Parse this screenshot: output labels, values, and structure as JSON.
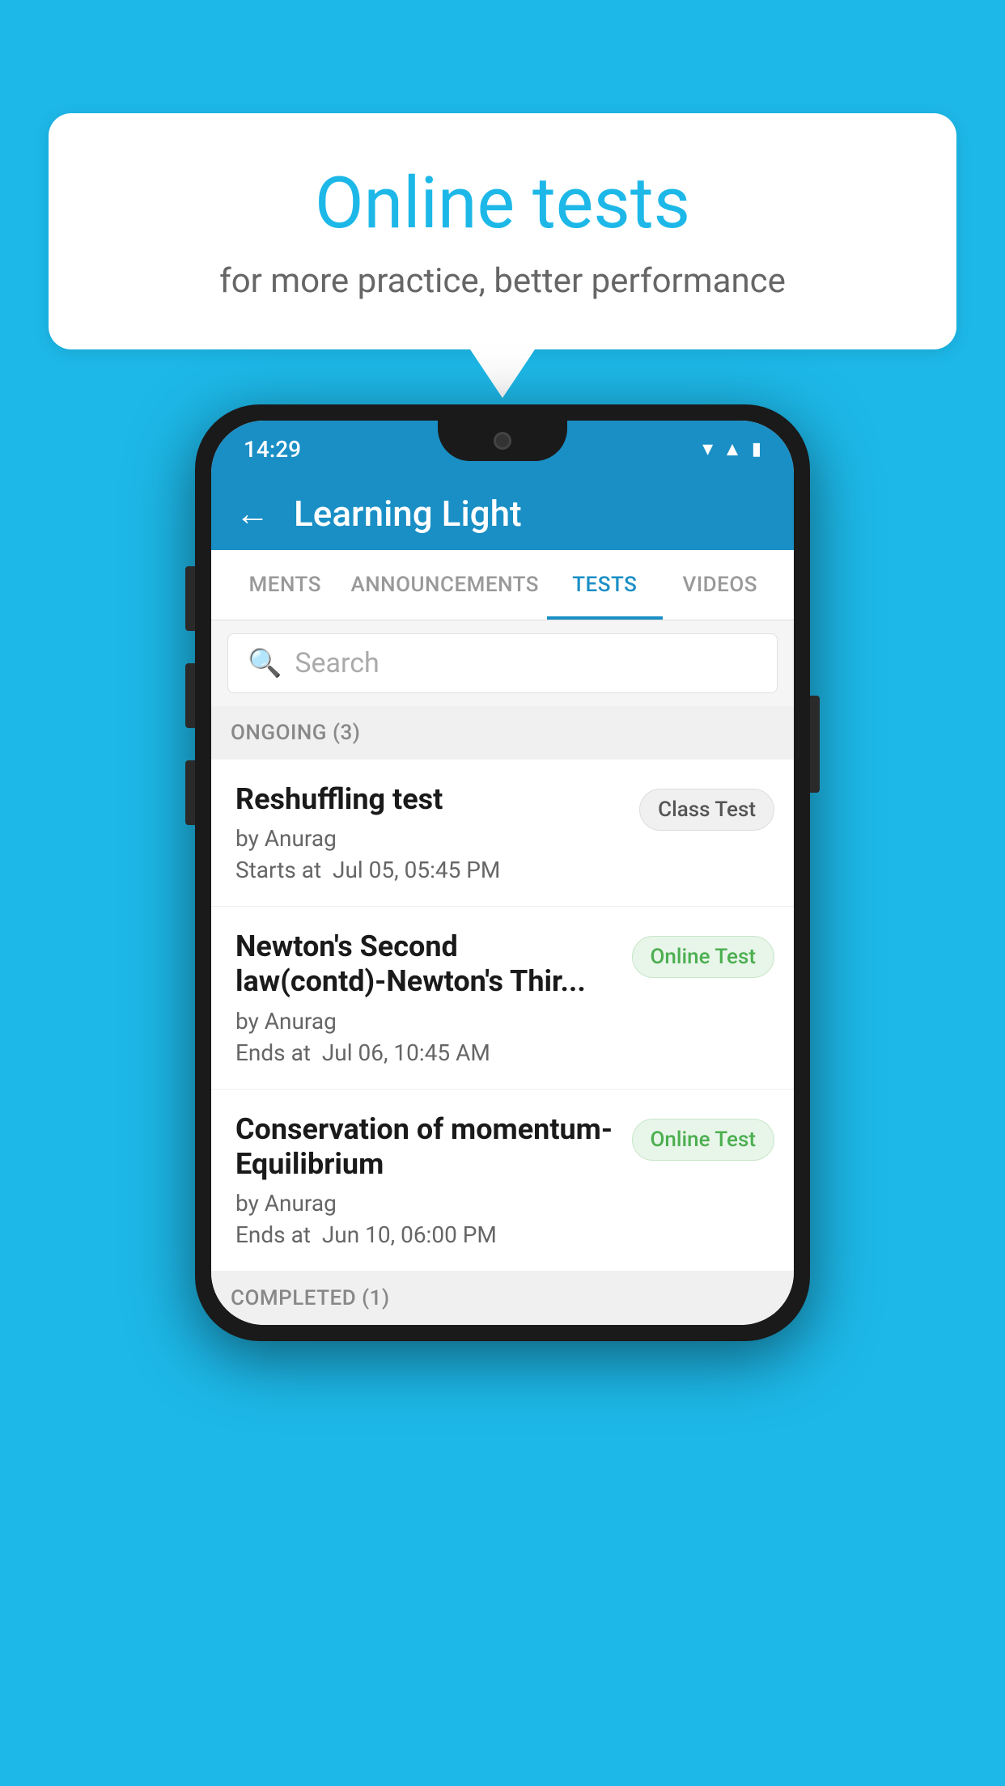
{
  "background": {
    "color": "#1db8e8"
  },
  "speech_bubble": {
    "title": "Online tests",
    "subtitle": "for more practice, better performance"
  },
  "phone": {
    "status_bar": {
      "time": "14:29",
      "icons": [
        "wifi",
        "signal",
        "battery"
      ]
    },
    "header": {
      "back_label": "←",
      "title": "Learning Light"
    },
    "tabs": [
      {
        "label": "MENTS",
        "active": false
      },
      {
        "label": "ANNOUNCEMENTS",
        "active": false
      },
      {
        "label": "TESTS",
        "active": true
      },
      {
        "label": "VIDEOS",
        "active": false
      }
    ],
    "search": {
      "placeholder": "Search"
    },
    "ongoing_section": {
      "label": "ONGOING (3)"
    },
    "tests": [
      {
        "name": "Reshuffling test",
        "author": "by Anurag",
        "time_label": "Starts at",
        "time": "Jul 05, 05:45 PM",
        "badge": "Class Test",
        "badge_type": "class"
      },
      {
        "name": "Newton's Second law(contd)-Newton's Thir...",
        "author": "by Anurag",
        "time_label": "Ends at",
        "time": "Jul 06, 10:45 AM",
        "badge": "Online Test",
        "badge_type": "online"
      },
      {
        "name": "Conservation of momentum-Equilibrium",
        "author": "by Anurag",
        "time_label": "Ends at",
        "time": "Jun 10, 06:00 PM",
        "badge": "Online Test",
        "badge_type": "online"
      }
    ],
    "completed_section": {
      "label": "COMPLETED (1)"
    }
  }
}
